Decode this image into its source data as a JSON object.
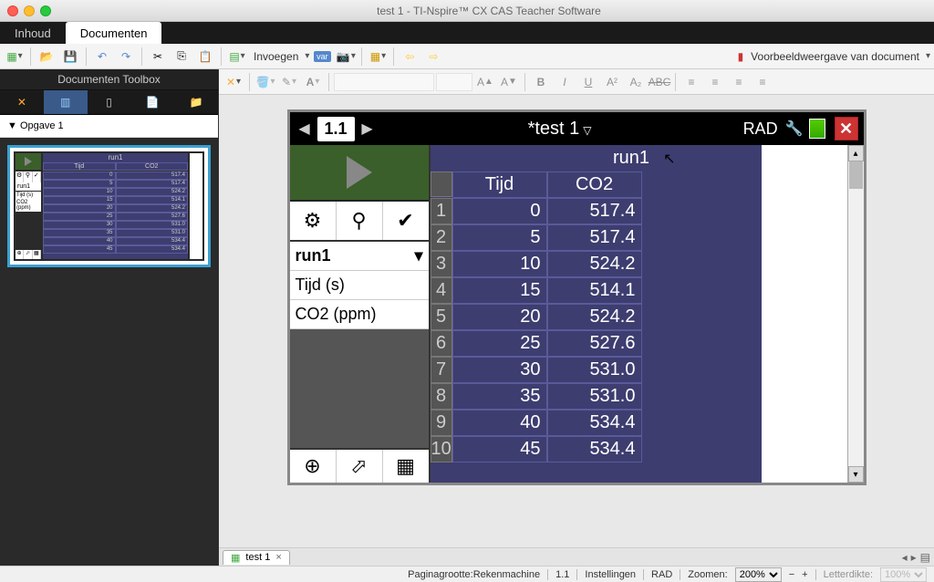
{
  "window_title": "test 1 - TI-Nspire™ CX CAS Teacher Software",
  "menubar": {
    "tabs": [
      "Inhoud",
      "Documenten"
    ],
    "active": 1
  },
  "toolbar1": {
    "insert_label": "Invoegen",
    "preview_label": "Voorbeeldweergave van document"
  },
  "sidebar": {
    "title": "Documenten Toolbox",
    "tree_root": "Opgave 1",
    "thumb_page": "1",
    "mini": {
      "title": "run1",
      "headers": [
        "Tijd",
        "CO2"
      ],
      "run": "run1",
      "var1": "Tijd (s)",
      "var2": "CO2 (ppm)",
      "rows": [
        [
          "0",
          "517.4"
        ],
        [
          "5",
          "517.4"
        ],
        [
          "10",
          "524.2"
        ],
        [
          "15",
          "514.1"
        ],
        [
          "20",
          "524.2"
        ],
        [
          "25",
          "527.6"
        ],
        [
          "30",
          "531.0"
        ],
        [
          "35",
          "531.0"
        ],
        [
          "40",
          "534.4"
        ],
        [
          "45",
          "534.4"
        ]
      ]
    }
  },
  "calculator": {
    "page_num": "1.1",
    "doc_title": "*test 1",
    "angle_mode": "RAD",
    "left_panel": {
      "run": "run1",
      "vars": [
        "Tijd (s)",
        "CO2  (ppm)"
      ]
    },
    "table": {
      "title": "run1",
      "columns": [
        "Tijd",
        "CO2"
      ],
      "rows": [
        {
          "idx": "1",
          "tijd": "0",
          "co2": "517.4"
        },
        {
          "idx": "2",
          "tijd": "5",
          "co2": "517.4"
        },
        {
          "idx": "3",
          "tijd": "10",
          "co2": "524.2"
        },
        {
          "idx": "4",
          "tijd": "15",
          "co2": "514.1"
        },
        {
          "idx": "5",
          "tijd": "20",
          "co2": "524.2"
        },
        {
          "idx": "6",
          "tijd": "25",
          "co2": "527.6"
        },
        {
          "idx": "7",
          "tijd": "30",
          "co2": "531.0"
        },
        {
          "idx": "8",
          "tijd": "35",
          "co2": "531.0"
        },
        {
          "idx": "9",
          "tijd": "40",
          "co2": "534.4"
        },
        {
          "idx": "10",
          "tijd": "45",
          "co2": "534.4"
        }
      ]
    }
  },
  "doc_tab": {
    "name": "test 1"
  },
  "statusbar": {
    "page_size": "Paginagrootte:Rekenmachine",
    "page": "1.1",
    "settings": "Instellingen",
    "angle": "RAD",
    "zoom_label": "Zoomen:",
    "zoom": "200%",
    "letter_label": "Letterdikte:",
    "letter": "100%"
  },
  "chart_data": {
    "type": "table",
    "title": "run1",
    "columns": [
      "Tijd (s)",
      "CO2 (ppm)"
    ],
    "rows": [
      [
        0,
        517.4
      ],
      [
        5,
        517.4
      ],
      [
        10,
        524.2
      ],
      [
        15,
        514.1
      ],
      [
        20,
        524.2
      ],
      [
        25,
        527.6
      ],
      [
        30,
        531.0
      ],
      [
        35,
        531.0
      ],
      [
        40,
        534.4
      ],
      [
        45,
        534.4
      ]
    ]
  }
}
